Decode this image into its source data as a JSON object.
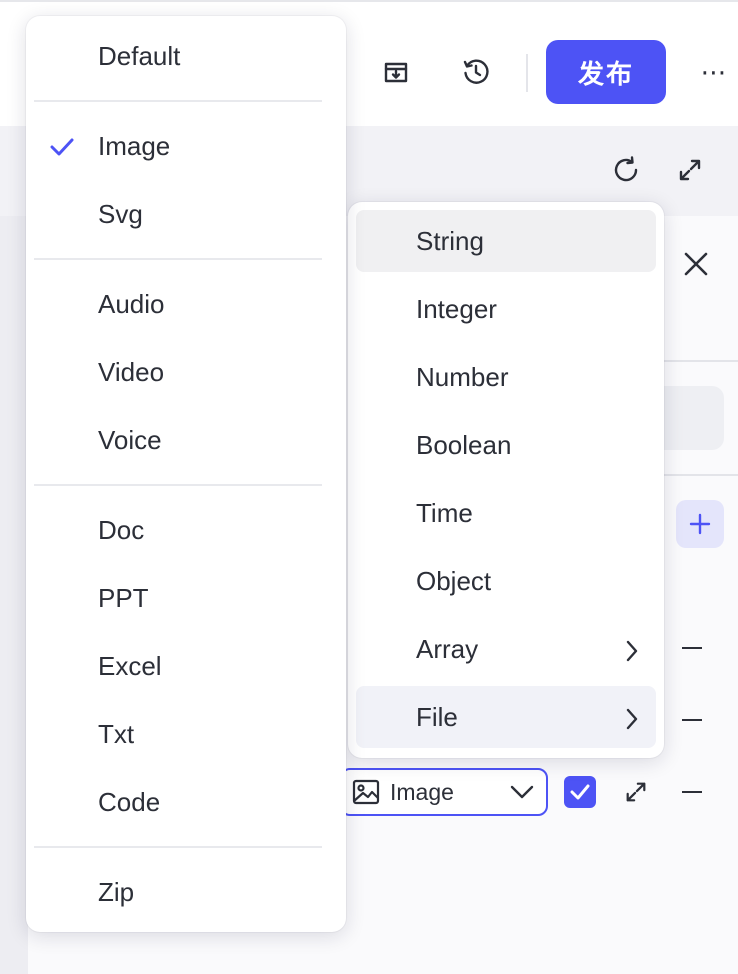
{
  "header": {
    "publish_label": "发布",
    "more_label": "⋯"
  },
  "file_type_menu": {
    "groups": [
      [
        "Default"
      ],
      [
        "Image",
        "Svg"
      ],
      [
        "Audio",
        "Video",
        "Voice"
      ],
      [
        "Doc",
        "PPT",
        "Excel",
        "Txt",
        "Code"
      ],
      [
        "Zip"
      ]
    ],
    "selected": "Image"
  },
  "data_type_menu": {
    "items": [
      {
        "label": "String",
        "state": "hover"
      },
      {
        "label": "Integer"
      },
      {
        "label": "Number"
      },
      {
        "label": "Boolean"
      },
      {
        "label": "Time"
      },
      {
        "label": "Object"
      },
      {
        "label": "Array",
        "has_submenu": true
      },
      {
        "label": "File",
        "has_submenu": true,
        "state": "active"
      }
    ]
  },
  "param_row": {
    "type_select_value": "Image",
    "required_checked": true
  },
  "colors": {
    "accent": "#4d53f5"
  }
}
